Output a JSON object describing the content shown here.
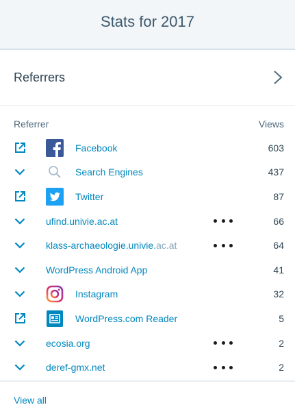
{
  "header": {
    "title": "Stats for 2017"
  },
  "panel": {
    "title": "Referrers"
  },
  "columns": {
    "referrer": "Referrer",
    "views": "Views"
  },
  "rows": [
    {
      "control": "external-link",
      "icon": "facebook-icon",
      "label": "Facebook",
      "label_suffix": "",
      "has_more": false,
      "views": "603"
    },
    {
      "control": "chevron-down",
      "icon": "search-icon",
      "label": "Search Engines",
      "label_suffix": "",
      "has_more": false,
      "views": "437"
    },
    {
      "control": "external-link",
      "icon": "twitter-icon",
      "label": "Twitter",
      "label_suffix": "",
      "has_more": false,
      "views": "87"
    },
    {
      "control": "chevron-down",
      "icon": "",
      "label": "ufind.univie.ac.at",
      "label_suffix": "",
      "has_more": true,
      "views": "66"
    },
    {
      "control": "chevron-down",
      "icon": "",
      "label": "klass-archaeologie.univie.",
      "label_suffix": "ac.at",
      "has_more": true,
      "views": "64"
    },
    {
      "control": "chevron-down",
      "icon": "",
      "label": "WordPress Android App",
      "label_suffix": "",
      "has_more": false,
      "views": "41"
    },
    {
      "control": "chevron-down",
      "icon": "instagram-icon",
      "label": "Instagram",
      "label_suffix": "",
      "has_more": false,
      "views": "32"
    },
    {
      "control": "external-link",
      "icon": "reader-icon",
      "label": "WordPress.com Reader",
      "label_suffix": "",
      "has_more": false,
      "views": "5"
    },
    {
      "control": "chevron-down",
      "icon": "",
      "label": "ecosia.org",
      "label_suffix": "",
      "has_more": true,
      "views": "2"
    },
    {
      "control": "chevron-down",
      "icon": "",
      "label": "deref-gmx.net",
      "label_suffix": "",
      "has_more": true,
      "views": "2"
    }
  ],
  "footer": {
    "view_all": "View all"
  },
  "colors": {
    "link": "#0087be",
    "text": "#2e4453",
    "muted": "#87a6bc",
    "facebook": "#3b5998",
    "twitter": "#1da1f2",
    "reader": "#0087be"
  }
}
